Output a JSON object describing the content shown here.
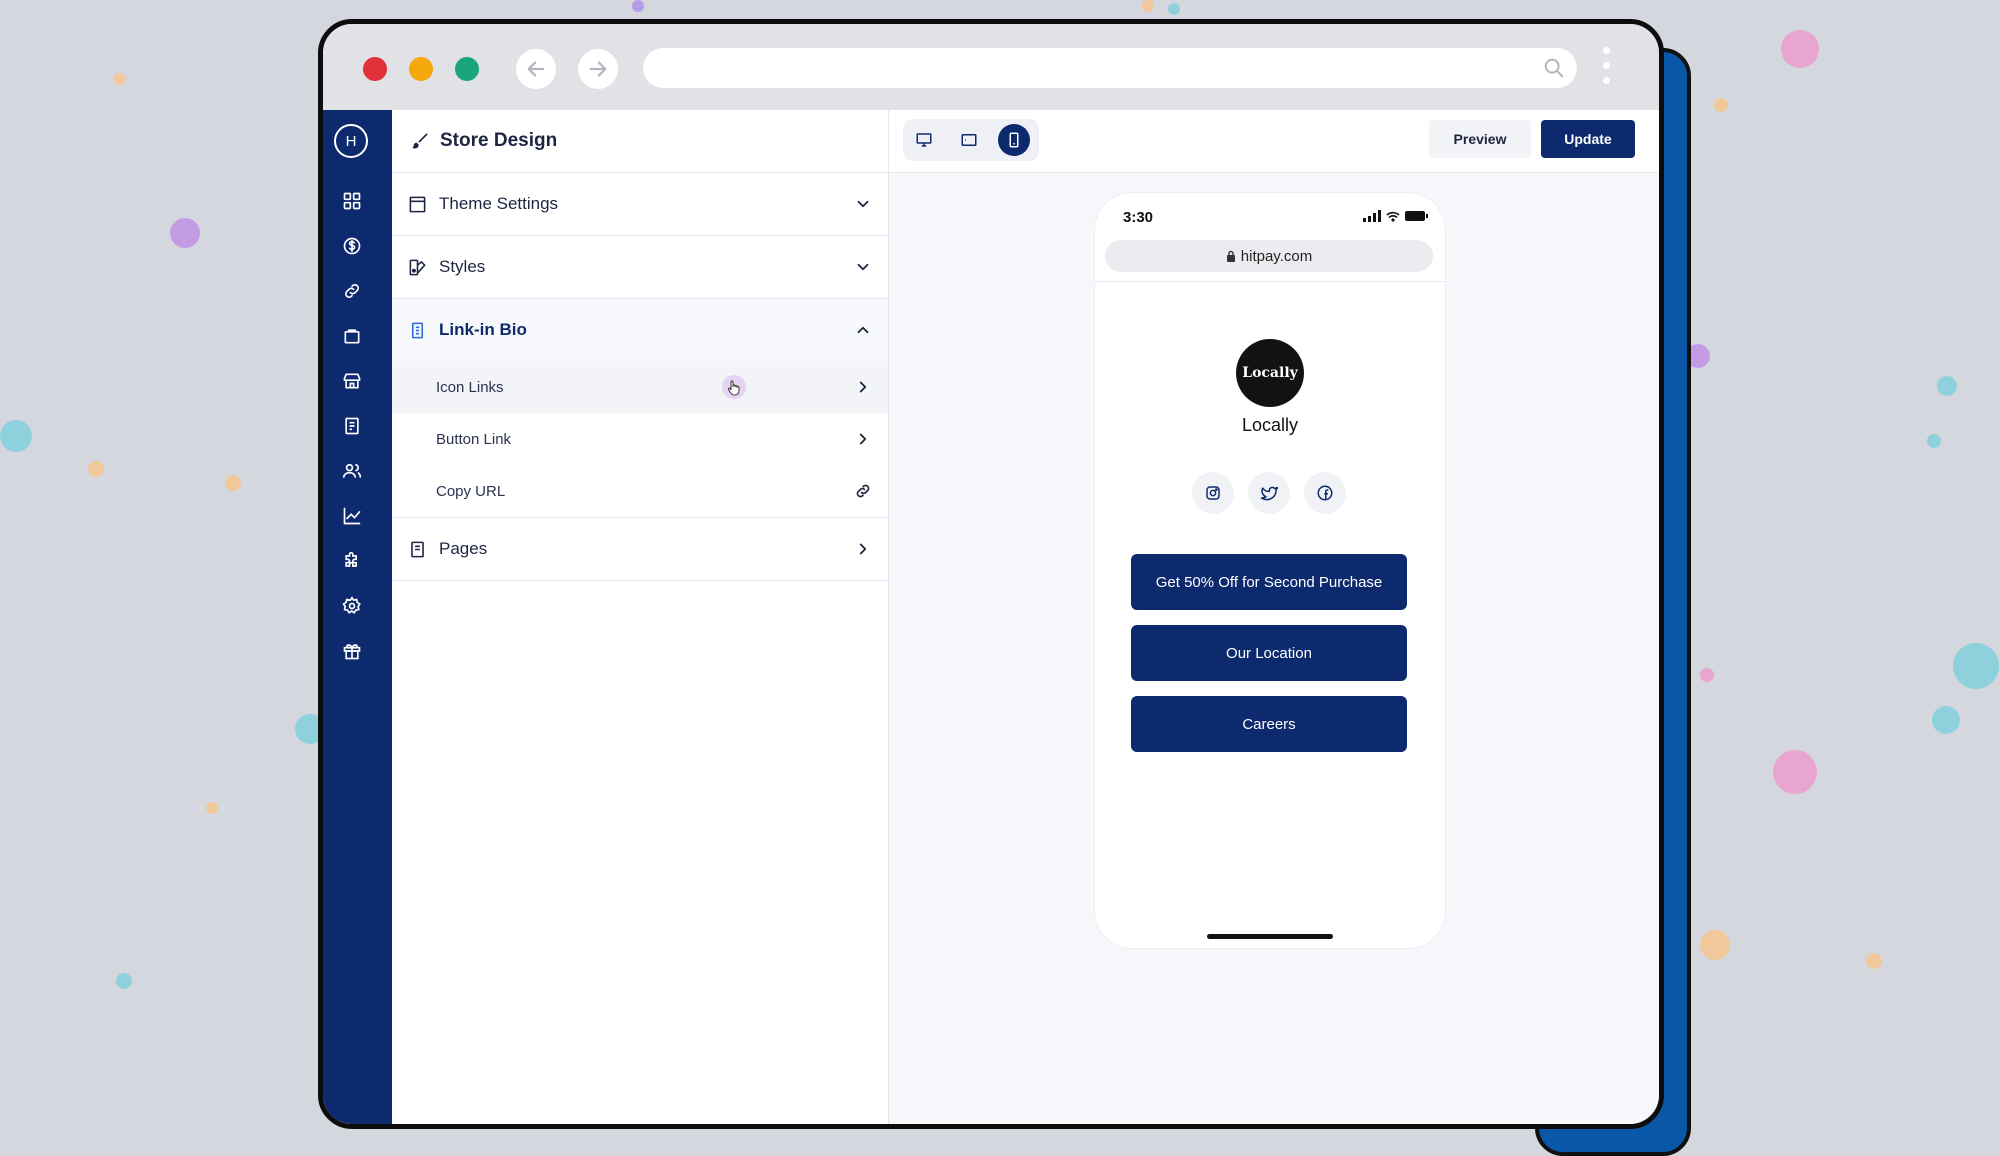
{
  "window": {
    "address_url": ""
  },
  "sidebar_rail": {
    "logo": "H",
    "icons": [
      "dashboard-icon",
      "dollar-icon",
      "link-icon",
      "bag-icon",
      "store-icon",
      "document-icon",
      "users-icon",
      "chart-icon",
      "puzzle-icon",
      "settings-icon",
      "gift-icon"
    ]
  },
  "panel": {
    "title": "Store Design",
    "sections": [
      {
        "label": "Theme Settings",
        "state": "collapsed"
      },
      {
        "label": "Styles",
        "state": "collapsed"
      },
      {
        "label": "Link-in Bio",
        "state": "expanded"
      },
      {
        "label": "Pages",
        "state": "collapsed"
      }
    ],
    "link_in_bio_items": [
      {
        "label": "Icon Links"
      },
      {
        "label": "Button Link"
      },
      {
        "label": "Copy URL"
      }
    ]
  },
  "preview": {
    "devices": [
      "desktop",
      "tablet",
      "mobile"
    ],
    "active_device": "mobile",
    "preview_label": "Preview",
    "update_label": "Update",
    "phone": {
      "time": "3:30",
      "url": "hitpay.com",
      "logo_text": "Locally",
      "store_name": "Locally",
      "social_icons": [
        "instagram-icon",
        "twitter-icon",
        "facebook-icon"
      ],
      "buttons": [
        {
          "label": "Get 50% Off for Second Purchase"
        },
        {
          "label": "Our Location"
        },
        {
          "label": "Careers"
        }
      ]
    }
  },
  "colors": {
    "brand_navy": "#0e2a6e",
    "close": "#e0303a",
    "minimize": "#f5a80c",
    "maximize": "#1aa67a"
  }
}
